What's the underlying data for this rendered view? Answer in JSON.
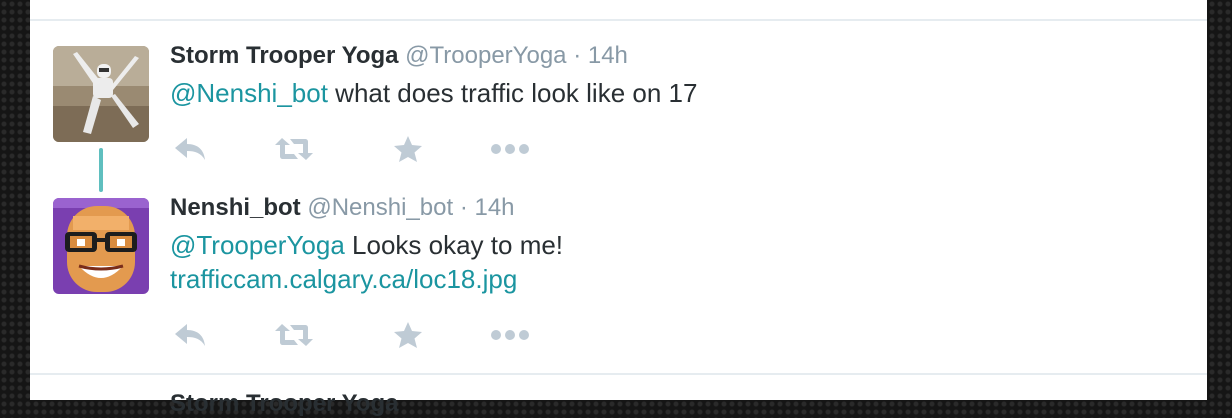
{
  "tweets": [
    {
      "name": "Storm Trooper Yoga",
      "handle": "@TrooperYoga",
      "separator": "·",
      "time": "14h",
      "mention": "@Nenshi_bot",
      "body": " what does traffic look like on 17",
      "link": ""
    },
    {
      "name": "Nenshi_bot",
      "handle": "@Nenshi_bot",
      "separator": "·",
      "time": "14h",
      "mention": "@TrooperYoga",
      "body": " Looks okay to me!",
      "link": "trafficcam.calgary.ca/loc18.jpg"
    }
  ],
  "next_tweet_partial_name": "Storm Trooper Yoga",
  "colors": {
    "link": "#1b95a0",
    "thread_line": "#5fbfbf",
    "action_icon": "#bfcbd5",
    "meta_text": "#8899a6"
  },
  "icons": [
    "reply-icon",
    "retweet-icon",
    "favorite-star-icon",
    "more-dots-icon"
  ]
}
